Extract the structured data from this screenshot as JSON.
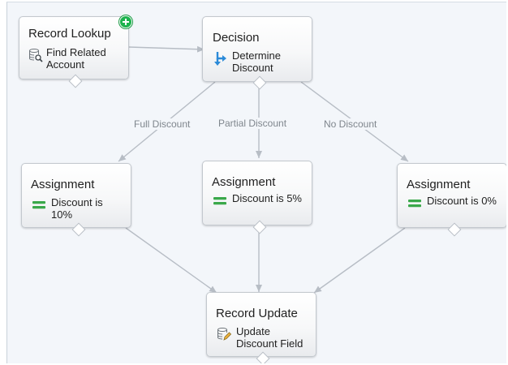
{
  "diagram": {
    "nodes": [
      {
        "id": "lookup",
        "type": "Record Lookup",
        "label": "Find Related Account",
        "icon": "record-lookup-icon",
        "is_start": true
      },
      {
        "id": "decision",
        "type": "Decision",
        "label": "Determine Discount",
        "icon": "decision-icon"
      },
      {
        "id": "assign_full",
        "type": "Assignment",
        "label": "Discount is 10%",
        "icon": "assignment-icon"
      },
      {
        "id": "assign_partial",
        "type": "Assignment",
        "label": "Discount is 5%",
        "icon": "assignment-icon"
      },
      {
        "id": "assign_none",
        "type": "Assignment",
        "label": "Discount is 0%",
        "icon": "assignment-icon"
      },
      {
        "id": "update",
        "type": "Record Update",
        "label": "Update Discount Field",
        "icon": "record-update-icon"
      }
    ],
    "edges": [
      {
        "from": "lookup",
        "to": "decision",
        "label": ""
      },
      {
        "from": "decision",
        "to": "assign_full",
        "label": "Full Discount"
      },
      {
        "from": "decision",
        "to": "assign_partial",
        "label": "Partial Discount"
      },
      {
        "from": "decision",
        "to": "assign_none",
        "label": "No Discount"
      },
      {
        "from": "assign_full",
        "to": "update",
        "label": ""
      },
      {
        "from": "assign_partial",
        "to": "update",
        "label": ""
      },
      {
        "from": "assign_none",
        "to": "update",
        "label": ""
      }
    ],
    "colors": {
      "canvas": "#f3f6fa",
      "connector_line": "#b7bdc5",
      "start_badge": "#1db34e",
      "decision_icon": "#2b8ad8",
      "assignment_icon": "#3aa84a"
    }
  }
}
